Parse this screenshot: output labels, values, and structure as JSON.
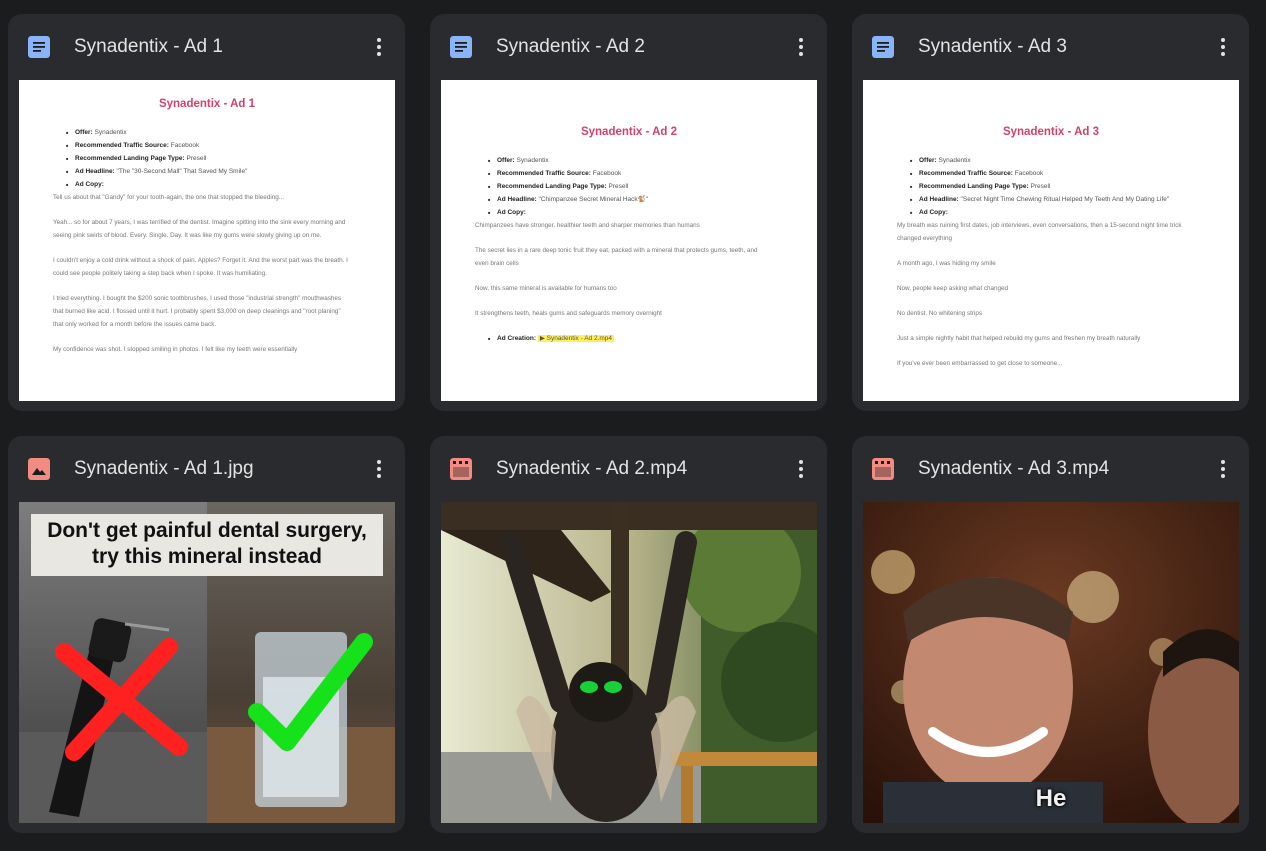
{
  "cards": [
    {
      "title": "Synadentix - Ad 1",
      "type": "document",
      "icon": "doc-icon",
      "preview": {
        "heading": "Synadentix - Ad 1",
        "offer_label": "Offer:",
        "offer": "Synadentix",
        "traffic_label": "Recommended Traffic Source:",
        "traffic": "Facebook",
        "landing_label": "Recommended Landing Page Type:",
        "landing": "Presell",
        "headline_label": "Ad Headline:",
        "headline": "\"The \"30-Second Mall\" That Saved My Smile\"",
        "copy_label": "Ad Copy:",
        "paragraphs": [
          "Tell us about that \"Gandy\" for your tooth-again, the one that stopped the bleeding...",
          "Yeah... so for about 7 years, I was terrified of the dentist. Imagine spitting into the sink every morning and seeing pink swirls of blood. Every. Single. Day. It was like my gums were slowly giving up on me.",
          "I couldn't enjoy a cold drink without a shock of pain. Apples? Forget it. And the worst part was the breath. I could see people politely taking a step back when I spoke. It was humiliating.",
          "I tried everything. I bought the $200 sonic toothbrushes. I used those \"industrial strength\" mouthwashes that burned like acid. I flossed until it hurt. I probably spent $3,000 on deep cleanings and \"root planing\" that only worked for a month before the issues came back.",
          "My confidence was shot. I stopped smiling in photos. I felt like my teeth were essentially"
        ]
      }
    },
    {
      "title": "Synadentix - Ad 2",
      "type": "document",
      "icon": "doc-icon",
      "preview": {
        "heading": "Synadentix - Ad 2",
        "offer_label": "Offer:",
        "offer": "Synadentix",
        "traffic_label": "Recommended Traffic Source:",
        "traffic": "Facebook",
        "landing_label": "Recommended Landing Page Type:",
        "landing": "Presell",
        "headline_label": "Ad Headline:",
        "headline": "\"Chimpanzee Secret Mineral Hack🐒\"",
        "copy_label": "Ad Copy:",
        "paragraphs": [
          "Chimpanzees have stronger, healthier teeth and sharper memories than humans",
          "The secret lies in a rare deep tonic fruit they eat, packed with a mineral that protects gums, teeth, and even brain cells",
          "Now, this same mineral is available for humans too",
          "It strengthens teeth, heals gums and safeguards memory overnight"
        ],
        "creation_label": "Ad Creation:",
        "creation_file": "▶ Synadentix - Ad 2.mp4"
      }
    },
    {
      "title": "Synadentix - Ad 3",
      "type": "document",
      "icon": "doc-icon",
      "preview": {
        "heading": "Synadentix - Ad 3",
        "offer_label": "Offer:",
        "offer": "Synadentix",
        "traffic_label": "Recommended Traffic Source:",
        "traffic": "Facebook",
        "landing_label": "Recommended Landing Page Type:",
        "landing": "Presell",
        "headline_label": "Ad Headline:",
        "headline": "\"Secret Night Time Chewing Ritual Helped My Teeth And My Dating Life\"",
        "copy_label": "Ad Copy:",
        "paragraphs": [
          "My breath was ruining first dates, job interviews, even conversations, then a 15-second night time trick changed everything",
          "A month ago, I was hiding my smile",
          "Now, people keep asking what changed",
          "No dentist. No whitening strips",
          "Just a simple nightly habit that helped rebuild my gums and freshen my breath naturally",
          "If you've ever been embarrassed to get close to someone..."
        ]
      }
    },
    {
      "title": "Synadentix - Ad 1.jpg",
      "type": "image",
      "icon": "image-icon",
      "preview": {
        "caption": "Don't get painful dental surgery, try this mineral instead"
      }
    },
    {
      "title": "Synadentix - Ad 2.mp4",
      "type": "video",
      "icon": "video-icon",
      "preview": {}
    },
    {
      "title": "Synadentix - Ad 3.mp4",
      "type": "video",
      "icon": "video-icon",
      "preview": {
        "subtitle": "He"
      }
    }
  ],
  "colors": {
    "background": "#1b1c1e",
    "card": "#2a2b2e",
    "doc_icon": "#8ab4f8",
    "media_icon": "#f28b82",
    "doc_heading": "#d0426a"
  }
}
